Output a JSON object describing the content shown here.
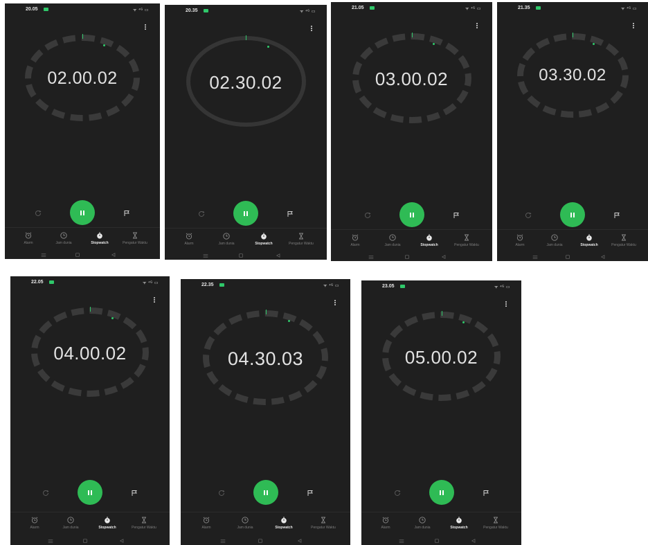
{
  "theme": {
    "background": "#1f1f1f",
    "accent": "#2fbb55",
    "ring": "#3a3a3a"
  },
  "status_icons_text": "ᯤ ⁴ᴳ ▭",
  "icons": {
    "menu": "more-vert-icon",
    "reset": "refresh-icon",
    "pause": "pause-icon",
    "lap": "flag-icon",
    "alarm": "alarm-clock-icon",
    "world_clock": "clock-icon",
    "stopwatch": "stopwatch-icon",
    "timer": "hourglass-icon"
  },
  "tabs": [
    "Alarm",
    "Jam dunia",
    "Stopwatch",
    "Pengatur Waktu"
  ],
  "screens": [
    {
      "status_time": "20.05",
      "stopwatch_time": "02.00.02"
    },
    {
      "status_time": "20.35",
      "stopwatch_time": "02.30.02"
    },
    {
      "status_time": "21.05",
      "stopwatch_time": "03.00.02"
    },
    {
      "status_time": "21.35",
      "stopwatch_time": "03.30.02"
    },
    {
      "status_time": "22.05",
      "stopwatch_time": "04.00.02"
    },
    {
      "status_time": "22.35",
      "stopwatch_time": "04.30.03"
    },
    {
      "status_time": "23.05",
      "stopwatch_time": "05.00.02"
    }
  ]
}
